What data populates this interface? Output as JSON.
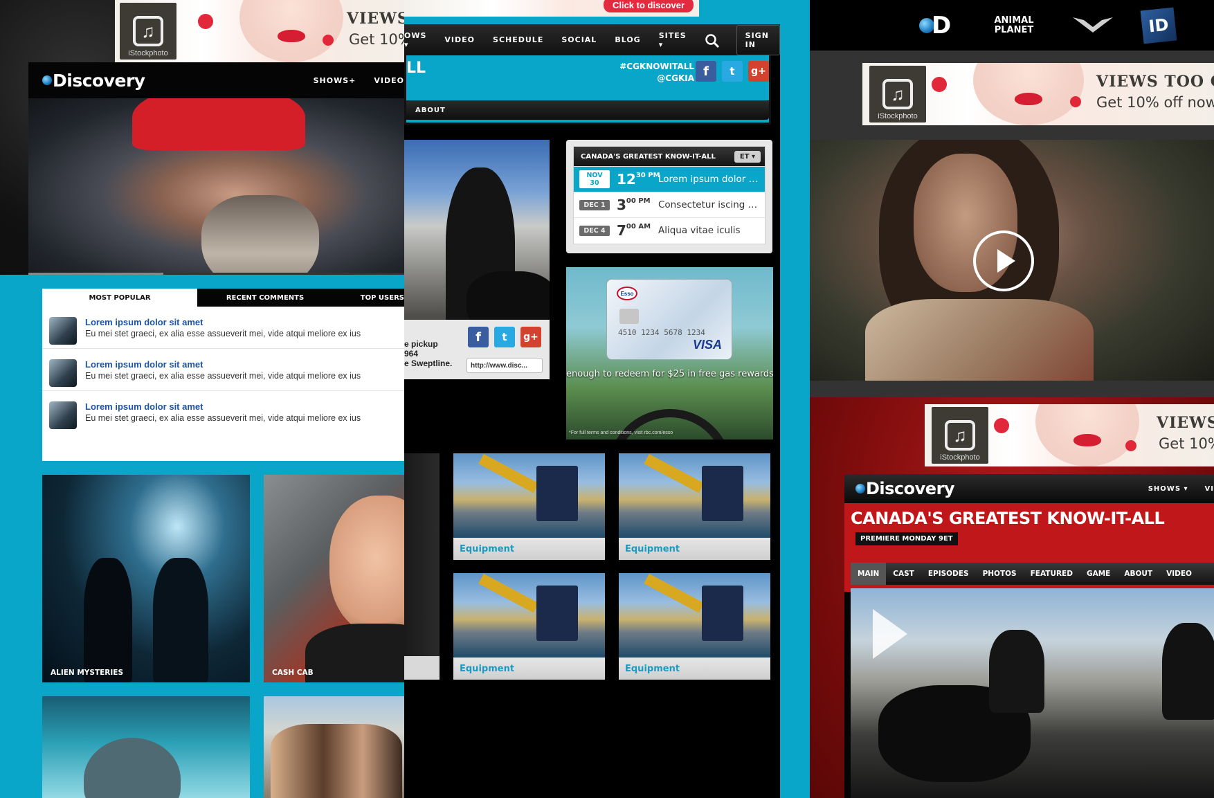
{
  "ad": {
    "headline": "VIEWS TOO GOOD",
    "offer": "Get 10% off now.",
    "brand": "iStockphoto",
    "cta": "Click to discover"
  },
  "left": {
    "logo": "Discovery",
    "nav": [
      "SHOWS+",
      "VIDEO"
    ],
    "widget": {
      "tabs": [
        "MOST POPULAR",
        "RECENT COMMENTS",
        "TOP USERS"
      ],
      "items": [
        {
          "title": "Lorem ipsum dolor sit amet",
          "desc": "Eu mei stet graeci, ex alia esse assueverit mei, vide atqui meliore ex ius"
        },
        {
          "title": "Lorem ipsum dolor sit amet",
          "desc": "Eu mei stet graeci, ex alia esse assueverit mei, vide atqui meliore ex ius"
        },
        {
          "title": "Lorem ipsum dolor sit amet",
          "desc": "Eu mei stet graeci, ex alia esse assueverit mei, vide atqui meliore ex ius"
        }
      ]
    },
    "tiles": [
      "ALIEN MYSTERIES",
      "CASH CAB"
    ]
  },
  "center": {
    "nav": [
      "SHOWS",
      "VIDEO",
      "SCHEDULE",
      "SOCIAL",
      "BLOG",
      "SITES"
    ],
    "signin": "SIGN IN",
    "title_fragment": "LL",
    "hashtag": "#CGKNOWITALL",
    "handle": "@CGKIA",
    "subnav": [
      "ABOUT"
    ],
    "schedule": {
      "title": "CANADA'S GREATEST KNOW-IT-ALL",
      "timezone": "ET",
      "rows": [
        {
          "date": "NOV 30",
          "hour": "12",
          "min": "30",
          "ampm": "PM",
          "title": "Lorem ipsum dolor sit amet"
        },
        {
          "date": "DEC 1",
          "hour": "3",
          "min": "00",
          "ampm": "PM",
          "title": "Consectetur iscing elit"
        },
        {
          "date": "DEC 4",
          "hour": "7",
          "min": "00",
          "ampm": "AM",
          "title": "Aliqua vitae iculis"
        }
      ]
    },
    "promo": {
      "text": "enough to redeem for $25 in free gas rewards",
      "fine": "*For full terms and conditions, visit rbc.com/esso",
      "card_number": "4510 1234 5678 1234",
      "card_brand": "VISA",
      "esso": "Esso"
    },
    "video_strip": {
      "lines": [
        "e pickup",
        "964",
        "e Sweptline."
      ],
      "url": "http://www.disc..."
    },
    "equipment": [
      "Equipment",
      "Equipment",
      "Equipment",
      "Equipment"
    ]
  },
  "right": {
    "networks": [
      "D",
      "ANIMAL PLANET",
      "V",
      "ID"
    ],
    "logo": "Discovery",
    "nav": [
      "SHOWS ▾",
      "VI"
    ],
    "show_title": "CANADA'S GREATEST KNOW-IT-ALL",
    "premiere": "PREMIERE MONDAY 9ET",
    "tabs": [
      "MAIN",
      "CAST",
      "EPISODES",
      "PHOTOS",
      "FEATURED",
      "GAME",
      "ABOUT",
      "VIDEO"
    ]
  },
  "colors": {
    "accent": "#0aa6c9",
    "red": "#c0171a",
    "link": "#1b54a8",
    "facebook": "#3a5da0",
    "twitter": "#29a9e1",
    "google": "#d3422f"
  }
}
